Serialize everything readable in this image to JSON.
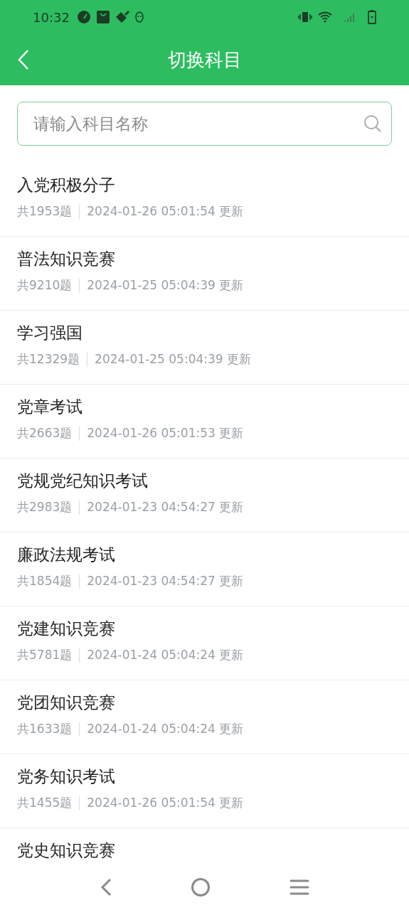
{
  "status_bar": {
    "time": "10:32"
  },
  "header": {
    "title": "切换科目"
  },
  "search": {
    "placeholder": "请输入科目名称"
  },
  "subjects": [
    {
      "title": "入党积极分子",
      "count": "共1953题",
      "updated": "2024-01-26 05:01:54 更新"
    },
    {
      "title": "普法知识竞赛",
      "count": "共9210题",
      "updated": "2024-01-25 05:04:39 更新"
    },
    {
      "title": "学习强国",
      "count": "共12329题",
      "updated": "2024-01-25 05:04:39 更新"
    },
    {
      "title": "党章考试",
      "count": "共2663题",
      "updated": "2024-01-26 05:01:53 更新"
    },
    {
      "title": "党规党纪知识考试",
      "count": "共2983题",
      "updated": "2024-01-23 04:54:27 更新"
    },
    {
      "title": "廉政法规考试",
      "count": "共1854题",
      "updated": "2024-01-23 04:54:27 更新"
    },
    {
      "title": "党建知识竞赛",
      "count": "共5781题",
      "updated": "2024-01-24 05:04:24 更新"
    },
    {
      "title": "党团知识竞赛",
      "count": "共1633题",
      "updated": "2024-01-24 05:04:24 更新"
    },
    {
      "title": "党务知识考试",
      "count": "共1455题",
      "updated": "2024-01-26 05:01:54 更新"
    },
    {
      "title": "党史知识竞赛"
    }
  ]
}
